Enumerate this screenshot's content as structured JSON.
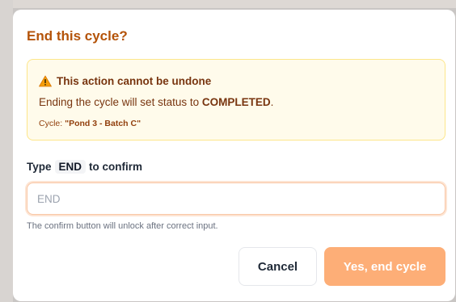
{
  "dialog": {
    "title": "End this cycle?",
    "warning": {
      "heading": "This action cannot be undone",
      "line_prefix": "Ending the cycle will set status to ",
      "status": "COMPLETED",
      "line_suffix": ".",
      "cycle_label": "Cycle: ",
      "cycle_name": "\"Pond 3 - Batch C\""
    },
    "confirm": {
      "label_prefix": "Type",
      "code": "END",
      "label_suffix": "to confirm",
      "input_value": "",
      "placeholder": "END",
      "hint": "The confirm button will unlock after correct input."
    },
    "buttons": {
      "cancel": "Cancel",
      "confirm": "Yes, end cycle",
      "confirm_enabled": false
    }
  },
  "colors": {
    "title": "#b45309",
    "warning_bg": "#fffbeb",
    "warning_border": "#fde68a",
    "warning_icon": "#f59e0b",
    "confirm_button_disabled": "#fdae77",
    "input_focus_border": "#f9c7a6"
  },
  "icons": {
    "warning": "warning-triangle-icon"
  }
}
